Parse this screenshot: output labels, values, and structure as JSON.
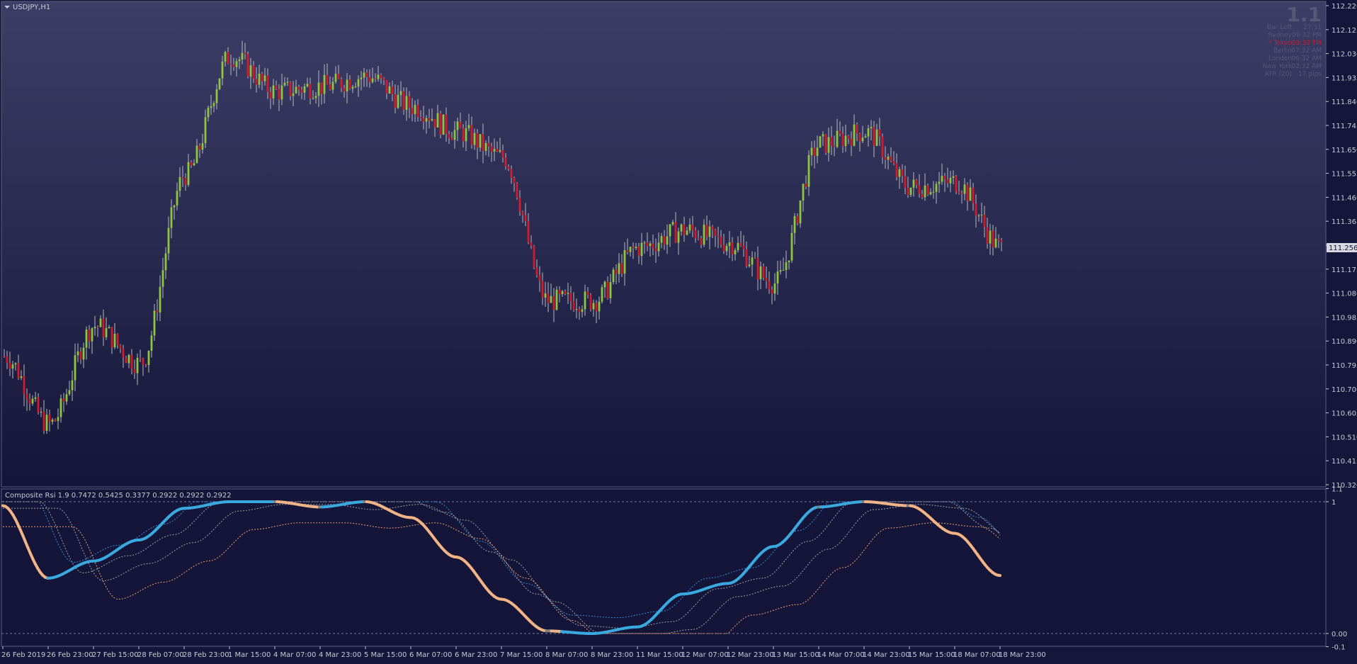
{
  "window": {
    "symbol_label": "USDJPY,H1",
    "version_badge": "1.1"
  },
  "info_panel": {
    "lines": [
      {
        "label": "Bar Left",
        "value": "27:31",
        "color": "#55587a"
      },
      {
        "label": "Sydney",
        "value": "06:32 PM",
        "color": "#55587a"
      },
      {
        "label": "* Tokyo",
        "value": "03:32 PM",
        "color": "#d01c2c"
      },
      {
        "label": "Berlin",
        "value": "07:32 AM",
        "color": "#55587a"
      },
      {
        "label": "London",
        "value": "06:32 AM",
        "color": "#55587a"
      },
      {
        "label": "New York",
        "value": "02:32 AM",
        "color": "#55587a"
      },
      {
        "label": "ATR (20)",
        "value": "17 pips",
        "color": "#55587a"
      }
    ]
  },
  "price_axis": {
    "ticks": [
      "112.220",
      "112.125",
      "112.030",
      "111.935",
      "111.840",
      "111.745",
      "111.650",
      "111.555",
      "111.460",
      "111.365",
      "111.270",
      "111.175",
      "111.080",
      "110.985",
      "110.890",
      "110.795",
      "110.700",
      "110.605",
      "110.510",
      "110.415",
      "110.320"
    ],
    "current_price": "111.256",
    "range": [
      110.32,
      112.22
    ]
  },
  "indicator": {
    "title": "Composite Rsi  1.9 0.7472 0.5425 0.3377 0.2922 0.2922 0.2922",
    "axis_ticks": [
      "1.1",
      "1",
      "0.00",
      "-0.1"
    ],
    "range": [
      -0.1,
      1.1
    ]
  },
  "time_axis": {
    "labels": [
      "26 Feb 2019",
      "26 Feb 23:00",
      "27 Feb 15:00",
      "28 Feb 07:00",
      "28 Feb 23:00",
      "1 Mar 15:00",
      "4 Mar 07:00",
      "4 Mar 23:00",
      "5 Mar 15:00",
      "6 Mar 07:00",
      "6 Mar 23:00",
      "7 Mar 15:00",
      "8 Mar 07:00",
      "8 Mar 23:00",
      "11 Mar 15:00",
      "12 Mar 07:00",
      "12 Mar 23:00",
      "13 Mar 15:00",
      "14 Mar 07:00",
      "14 Mar 23:00",
      "15 Mar 15:00",
      "18 Mar 07:00",
      "18 Mar 23:00"
    ]
  },
  "colors": {
    "background_top": "#3c3e66",
    "background_bottom": "#141538",
    "bull_candle": "#8dc63f",
    "bear_candle": "#d01c2c",
    "rsi_up": "#3aa9e0",
    "rsi_down": "#f0b487",
    "rsi_neutral": "#808080",
    "band_blue": "#2f8fd8",
    "band_orange": "#e8a070",
    "band_gray": "#a0a0a8",
    "text": "#c8c8d8"
  },
  "chart_data": {
    "type": "candlestick",
    "x_labels_ref": "time_axis.labels",
    "ylim": [
      110.32,
      112.22
    ],
    "approx_close_path": [
      {
        "label": "26 Feb 2019",
        "value": 110.83
      },
      {
        "label": "26 Feb 23:00",
        "value": 110.56
      },
      {
        "label": "27 Feb 15:00",
        "value": 110.95
      },
      {
        "label": "28 Feb 07:00",
        "value": 110.8
      },
      {
        "label": "28 Feb 23:00",
        "value": 111.55
      },
      {
        "label": "1 Mar 15:00",
        "value": 112.02
      },
      {
        "label": "4 Mar 07:00",
        "value": 111.88
      },
      {
        "label": "4 Mar 23:00",
        "value": 111.9
      },
      {
        "label": "5 Mar 15:00",
        "value": 111.94
      },
      {
        "label": "6 Mar 07:00",
        "value": 111.82
      },
      {
        "label": "6 Mar 23:00",
        "value": 111.72
      },
      {
        "label": "7 Mar 15:00",
        "value": 111.62
      },
      {
        "label": "8 Mar 07:00",
        "value": 111.05
      },
      {
        "label": "8 Mar 23:00",
        "value": 111.05
      },
      {
        "label": "11 Mar 15:00",
        "value": 111.26
      },
      {
        "label": "12 Mar 07:00",
        "value": 111.33
      },
      {
        "label": "12 Mar 23:00",
        "value": 111.28
      },
      {
        "label": "13 Mar 15:00",
        "value": 111.12
      },
      {
        "label": "14 Mar 07:00",
        "value": 111.67
      },
      {
        "label": "14 Mar 23:00",
        "value": 111.72
      },
      {
        "label": "15 Mar 15:00",
        "value": 111.5
      },
      {
        "label": "18 Mar 07:00",
        "value": 111.52
      },
      {
        "label": "18 Mar 23:00",
        "value": 111.26
      }
    ],
    "rsi_path": [
      {
        "label": "26 Feb 2019",
        "value": 0.97
      },
      {
        "label": "26 Feb 23:00",
        "value": 0.42
      },
      {
        "label": "27 Feb 15:00",
        "value": 0.55
      },
      {
        "label": "28 Feb 07:00",
        "value": 0.71
      },
      {
        "label": "28 Feb 23:00",
        "value": 0.95
      },
      {
        "label": "1 Mar 15:00",
        "value": 1.0
      },
      {
        "label": "4 Mar 07:00",
        "value": 1.0
      },
      {
        "label": "4 Mar 23:00",
        "value": 0.96
      },
      {
        "label": "5 Mar 15:00",
        "value": 1.0
      },
      {
        "label": "6 Mar 07:00",
        "value": 0.88
      },
      {
        "label": "6 Mar 23:00",
        "value": 0.58
      },
      {
        "label": "7 Mar 15:00",
        "value": 0.26
      },
      {
        "label": "8 Mar 07:00",
        "value": 0.02
      },
      {
        "label": "8 Mar 23:00",
        "value": 0.0
      },
      {
        "label": "11 Mar 15:00",
        "value": 0.05
      },
      {
        "label": "12 Mar 07:00",
        "value": 0.3
      },
      {
        "label": "12 Mar 23:00",
        "value": 0.38
      },
      {
        "label": "13 Mar 15:00",
        "value": 0.66
      },
      {
        "label": "14 Mar 07:00",
        "value": 0.96
      },
      {
        "label": "14 Mar 23:00",
        "value": 1.0
      },
      {
        "label": "15 Mar 15:00",
        "value": 0.97
      },
      {
        "label": "18 Mar 07:00",
        "value": 0.76
      },
      {
        "label": "18 Mar 23:00",
        "value": 0.44
      }
    ]
  }
}
